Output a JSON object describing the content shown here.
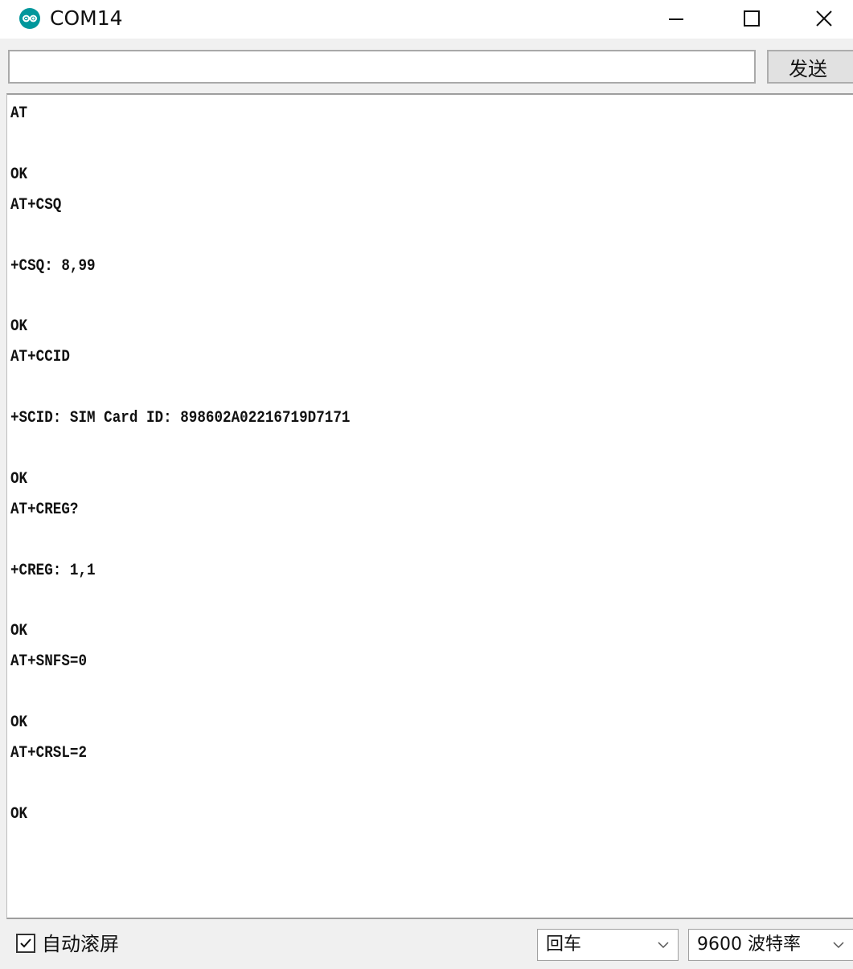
{
  "window": {
    "title": "COM14",
    "icon": "arduino-logo-icon",
    "controls": [
      "minimize-icon",
      "maximize-icon",
      "close-icon"
    ]
  },
  "send_bar": {
    "input_value": "",
    "send_label": "发送"
  },
  "serial_output": [
    "AT",
    "",
    "OK",
    "AT+CSQ",
    "",
    "+CSQ: 8,99",
    "",
    "OK",
    "AT+CCID",
    "",
    "+SCID: SIM Card ID: 898602A02216719D7171",
    "",
    "OK",
    "AT+CREG?",
    "",
    "+CREG: 1,1",
    "",
    "OK",
    "AT+SNFS=0",
    "",
    "OK",
    "AT+CRSL=2",
    "",
    "OK"
  ],
  "footer": {
    "autoscroll_label": "自动滚屏",
    "autoscroll_checked": true,
    "line_ending_selected": "回车",
    "baud_rate_selected": "9600 波特率"
  },
  "colors": {
    "arduino_teal": "#00979c",
    "window_bg": "#f0f0f0",
    "monitor_bg": "#ffffff"
  }
}
